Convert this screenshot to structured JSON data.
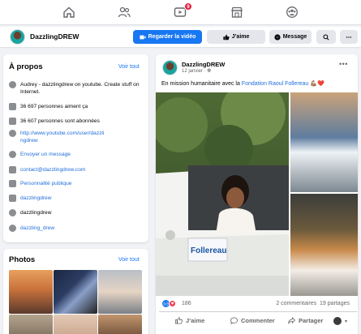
{
  "nav": {
    "notification_badge": "9"
  },
  "pagebar": {
    "name": "DazzlingDREW",
    "watch_label": "Regarder la vidéo",
    "like_label": "J’aime",
    "message_label": "Message"
  },
  "about": {
    "title": "À propos",
    "see_all": "Voir tout",
    "rows": [
      {
        "icon": "info-icon",
        "text": "Audrey - dazzlingdrew on youtube. Create stuff on Internet."
      },
      {
        "icon": "thumbs-up-icon",
        "text": "36 697 personnes aiment ça"
      },
      {
        "icon": "followers-icon",
        "text": "36 607 personnes sont abonnées"
      },
      {
        "icon": "globe-icon",
        "text": "http://www.youtube.com/user/dazzlingdrew"
      },
      {
        "icon": "messenger-icon",
        "text": "Envoyer un message"
      },
      {
        "icon": "email-icon",
        "text": "contact@dazzlingdrew.com"
      },
      {
        "icon": "tag-icon",
        "text": "Personnalité publique"
      },
      {
        "icon": "instagram-icon",
        "text": "dazzlingdrew"
      },
      {
        "icon": "snapchat-icon",
        "text": "dazzlingdrew"
      },
      {
        "icon": "twitter-icon",
        "text": "dazzling_drew"
      }
    ]
  },
  "photos": {
    "title": "Photos",
    "see_all": "Voir tout"
  },
  "post": {
    "author": "DazzlingDREW",
    "date": "12 janvier · ",
    "text_prefix": "En mission humanitaire avec la ",
    "mention": "Fondation Raoul Follereau",
    "text_suffix": " 💪🏽❤️",
    "door_text": "Follereau",
    "reaction_count": "186",
    "comments": "2 commentaires",
    "shares": "19 partages",
    "like_label": "J’aime",
    "comment_label": "Commenter",
    "share_label": "Partager"
  }
}
